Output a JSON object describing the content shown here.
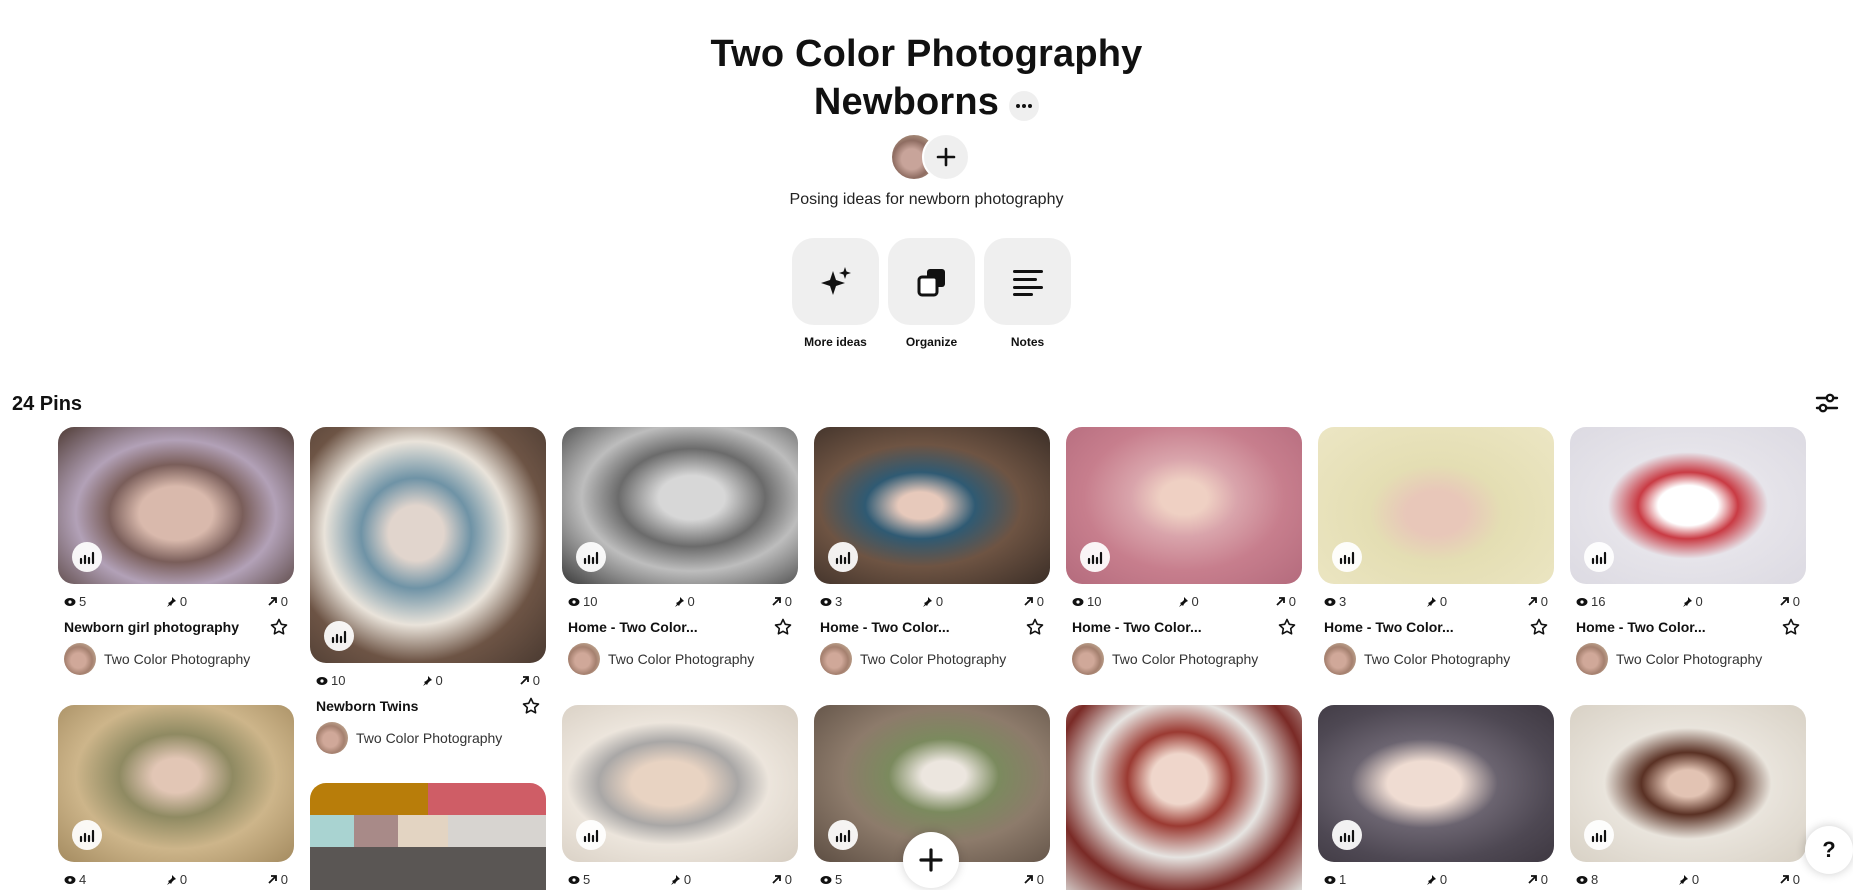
{
  "board": {
    "title_line1": "Two Color Photography",
    "title_line2": "Newborns",
    "more_icon": "ellipsis-icon",
    "description": "Posing ideas for newborn photography"
  },
  "actions": [
    {
      "label": "More ideas",
      "icon": "sparkle-icon"
    },
    {
      "label": "Organize",
      "icon": "organize-icon"
    },
    {
      "label": "Notes",
      "icon": "notes-icon"
    }
  ],
  "pins_count": "24 Pins",
  "owner_name": "Two Color Photography",
  "pins": [
    {
      "title": "Newborn girl photography",
      "views": "5",
      "saves": "0",
      "clicks": "0"
    },
    {
      "title": "Newborn Twins",
      "views": "10",
      "saves": "0",
      "clicks": "0"
    },
    {
      "title": "Home - Two Color...",
      "views": "10",
      "saves": "0",
      "clicks": "0"
    },
    {
      "title": "Home - Two Color...",
      "views": "3",
      "saves": "0",
      "clicks": "0"
    },
    {
      "title": "Home - Two Color...",
      "views": "10",
      "saves": "0",
      "clicks": "0"
    },
    {
      "title": "Home - Two Color...",
      "views": "3",
      "saves": "0",
      "clicks": "0"
    },
    {
      "title": "Home - Two Color...",
      "views": "16",
      "saves": "0",
      "clicks": "0"
    }
  ],
  "row2_stats": [
    {
      "views": "4",
      "saves": "0",
      "clicks": "0"
    },
    {
      "views": "5",
      "saves": "0",
      "clicks": "0"
    },
    {
      "views": "5",
      "saves": "",
      "clicks": "0"
    },
    {
      "views": "1",
      "saves": "0",
      "clicks": "0"
    },
    {
      "views": "8",
      "saves": "0",
      "clicks": "0"
    }
  ],
  "help_label": "?"
}
